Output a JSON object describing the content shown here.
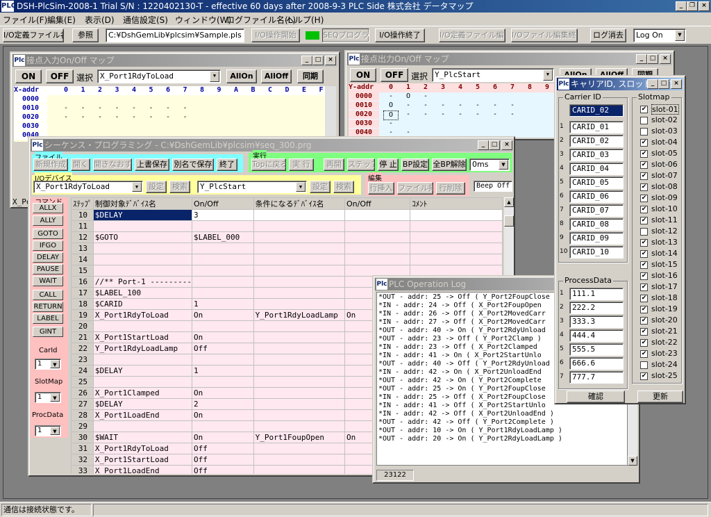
{
  "app": {
    "title": "DSH-PlcSim-2008-1 Trial S/N : 1220402130-T - effective 60 days after 2008-9-3     PLC Side  株式会社  データマップ",
    "logo": "PLC"
  },
  "menu": [
    "ファイル(F)",
    "編集(E)",
    "表示(D)",
    "通信設定(S)",
    "ウィンドウ(W)",
    "ログファイル名(L)",
    "ヘルプ(H)"
  ],
  "toolbar": {
    "io_def_label": "I/O定義ファイル名",
    "ref_btn": "参照",
    "file_path": "C:¥DshGemLib¥plcsim¥Sample.pls",
    "io_start": "I/O操作開始",
    "seq_prog": "SEQプログラム",
    "io_end": "I/O操作終了",
    "io_def_edit": "I/O定義ファイル編集",
    "io_file_edit_end": "I/Oファイル編集終了",
    "log_clear": "ログ消去",
    "log_on": "Log On"
  },
  "input_map": {
    "title": "接点入力On/Off マップ",
    "on": "ON",
    "off": "OFF",
    "select": "選択",
    "select_value": "X_Port1RdyToLoad",
    "allon": "AllOn",
    "alloff": "AllOff",
    "sync": "同期",
    "xaddr": "X-addr",
    "cols": [
      "0",
      "1",
      "2",
      "3",
      "4",
      "5",
      "6",
      "7",
      "8",
      "9",
      "A",
      "B",
      "C",
      "D",
      "E",
      "F"
    ],
    "rows": [
      "0000",
      "0010",
      "0020",
      "0030",
      "0040"
    ],
    "footer": "X_Po"
  },
  "output_map": {
    "title": "接点出力On/Off マップ",
    "on": "ON",
    "off": "OFF",
    "select": "選択",
    "select_value": "Y_PlcStart",
    "allon": "AllOn",
    "alloff": "AllOff",
    "sync": "同期",
    "yaddr": "Y-addr",
    "cols": [
      "0",
      "1",
      "2",
      "3",
      "4",
      "5",
      "6",
      "7",
      "8",
      "9"
    ],
    "rows": [
      "0000",
      "0010",
      "0020",
      "0030",
      "0040"
    ],
    "marks": {
      "r0": [
        "-",
        "O",
        "-"
      ],
      "r1": [
        "O",
        "-",
        "-",
        "-",
        "-",
        "-",
        "-",
        "-"
      ],
      "r2": [
        "O",
        "-",
        "-",
        "-",
        "-",
        "-",
        "-",
        "-"
      ],
      "r3": [
        "-"
      ],
      "r4": [
        "-",
        "-"
      ]
    }
  },
  "seq": {
    "title": "シーケンス・プログラミング - C:¥DshGemLib¥plcsim¥seq_300.prg",
    "file_label": "ファイル",
    "file_btns": [
      "新規作成",
      "開く",
      "開きなおす",
      "上書保存",
      "別名で保存",
      "終了"
    ],
    "exec_label": "実行",
    "exec_btns": [
      "Topに戻る",
      "実 行",
      "再開",
      "ステップ",
      "停 止",
      "BP設定",
      "全BP解除"
    ],
    "ms_value": "0ms",
    "io_label": "I/Oデバイス",
    "io_in": "X_Port1RdyToLoad",
    "set1": "設定",
    "search1": "検索",
    "io_out": "Y_PlcStart",
    "set2": "設定",
    "search2": "検索",
    "edit_label": "編集",
    "edit_btns": [
      "行挿入",
      "ファイル挿入",
      "行削除"
    ],
    "beep": "Beep Off",
    "cmd_label": "コマンド",
    "cmds": [
      "ALLX",
      "ALLY",
      "GOTO",
      "IFGO",
      "DELAY",
      "PAUSE",
      "WAIT",
      "CALL",
      "RETURN",
      "LABEL",
      "GINT"
    ],
    "carid_label": "CarId",
    "slotmap_label": "SlotMap",
    "procdata_label": "ProcData",
    "spin_value": "1",
    "headers": [
      "ｽﾃｯﾌﾟ",
      "制御対象ﾃﾞﾊﾞｲｽ名",
      "On/Off",
      "条件になるﾃﾞﾊﾞｲｽ名",
      "On/Off",
      "ｺﾒﾝﾄ"
    ],
    "rows": [
      [
        "10",
        "$DELAY",
        "3",
        "",
        "",
        ""
      ],
      [
        "11",
        "",
        "",
        "",
        "",
        ""
      ],
      [
        "12",
        "$GOTO",
        "$LABEL_000",
        "",
        "",
        ""
      ],
      [
        "13",
        "",
        "",
        "",
        "",
        ""
      ],
      [
        "14",
        "",
        "",
        "",
        "",
        ""
      ],
      [
        "15",
        "",
        "",
        "",
        "",
        ""
      ],
      [
        "16",
        "//** Port-1 ---------",
        "",
        "",
        "",
        ""
      ],
      [
        "17",
        "$LABEL_100",
        "",
        "",
        "",
        ""
      ],
      [
        "18",
        "$CARID",
        "1",
        "",
        "",
        ""
      ],
      [
        "19",
        "X_Port1RdyToLoad",
        "On",
        "Y_Port1RdyLoadLamp",
        "On",
        ""
      ],
      [
        "20",
        "",
        "",
        "",
        "",
        ""
      ],
      [
        "21",
        "X_Port1StartLoad",
        "On",
        "",
        "",
        ""
      ],
      [
        "22",
        "Y_Port1RdyLoadLamp",
        "Off",
        "",
        "",
        ""
      ],
      [
        "23",
        "",
        "",
        "",
        "",
        ""
      ],
      [
        "24",
        "$DELAY",
        "1",
        "",
        "",
        ""
      ],
      [
        "25",
        "",
        "",
        "",
        "",
        ""
      ],
      [
        "26",
        "X_Port1Clamped",
        "On",
        "",
        "",
        ""
      ],
      [
        "27",
        "$DELAY",
        "2",
        "",
        "",
        ""
      ],
      [
        "28",
        "X_Port1LoadEnd",
        "On",
        "",
        "",
        ""
      ],
      [
        "29",
        "",
        "",
        "",
        "",
        ""
      ],
      [
        "30",
        "$WAIT",
        "On",
        "Y_Port1FoupOpen",
        "On",
        ""
      ],
      [
        "31",
        "X_Port1RdyToLoad",
        "Off",
        "",
        "",
        ""
      ],
      [
        "32",
        "X_Port1StartLoad",
        "Off",
        "",
        "",
        ""
      ],
      [
        "33",
        "X_Port1LoadEnd",
        "Off",
        "",
        "",
        ""
      ]
    ]
  },
  "log": {
    "title": "PLC Operation Log",
    "lines": [
      "*OUT - addr:   25 -> Off ( Y_Port2FoupClose",
      "*IN  - addr:   24 -> Off ( X_Port2FoupOpen",
      "*IN  - addr:   26 -> Off ( X_Port2MovedCarr",
      "*IN  - addr:   27 -> Off ( X_Port2MovedCarr",
      "*OUT - addr:   40 -> On  ( Y_Port2RdyUnload",
      "*OUT - addr:   23 -> Off ( Y_Port2Clamp )",
      "*IN  - addr:   23 -> Off ( X_Port2Clamped",
      "*IN  - addr:   41 -> On  ( X_Port2StartUnlo",
      "*OUT - addr:   40 -> Off ( Y_Port2RdyUnload",
      "*IN  - addr:   42 -> On  ( X_Port2UnloadEnd",
      "*OUT - addr:   42 -> On  ( Y_Port2Complete",
      "*OUT - addr:   25 -> On  ( Y_Port2FoupClose",
      "*IN  - addr:   25 -> Off ( X_Port2FoupClose",
      "*IN  - addr:   41 -> Off ( X_Port2StartUnlo",
      "*IN  - addr:   42 -> Off ( X_Port2UnloadEnd )",
      "*OUT - addr:   42 -> Off ( Y_Port2Complete )",
      "*OUT - addr:   10 -> On  ( Y_Port1RdyLoadLamp )",
      "*OUT - addr:   20 -> On  ( Y_Port2RdyLoadLamp )"
    ],
    "count": "23122"
  },
  "carrier": {
    "title": "キャリアID, スロットマップ, ...",
    "carrier_label": "Carrier ID",
    "selected": "CARID_02",
    "ids": [
      "CARID_01",
      "CARID_02",
      "CARID_03",
      "CARID_04",
      "CARID_05",
      "CARID_06",
      "CARID_07",
      "CARID_08",
      "CARID_09",
      "CARID_10"
    ],
    "nums": [
      "1",
      "2",
      "3",
      "4",
      "5",
      "6",
      "7",
      "8",
      "9",
      "10"
    ],
    "slot_label": "Slotmap",
    "slots": [
      {
        "n": "slot-01",
        "c": true
      },
      {
        "n": "slot-02",
        "c": false
      },
      {
        "n": "slot-03",
        "c": false
      },
      {
        "n": "slot-04",
        "c": true
      },
      {
        "n": "slot-05",
        "c": true
      },
      {
        "n": "slot-06",
        "c": true
      },
      {
        "n": "slot-07",
        "c": true
      },
      {
        "n": "slot-08",
        "c": true
      },
      {
        "n": "slot-09",
        "c": true
      },
      {
        "n": "slot-10",
        "c": true
      },
      {
        "n": "slot-11",
        "c": true
      },
      {
        "n": "slot-12",
        "c": false
      },
      {
        "n": "slot-13",
        "c": true
      },
      {
        "n": "slot-14",
        "c": true
      },
      {
        "n": "slot-15",
        "c": true
      },
      {
        "n": "slot-16",
        "c": true
      },
      {
        "n": "slot-17",
        "c": true
      },
      {
        "n": "slot-18",
        "c": true
      },
      {
        "n": "slot-19",
        "c": true
      },
      {
        "n": "slot-20",
        "c": true
      },
      {
        "n": "slot-21",
        "c": true
      },
      {
        "n": "slot-22",
        "c": true
      },
      {
        "n": "slot-23",
        "c": true
      },
      {
        "n": "slot-24",
        "c": false
      },
      {
        "n": "slot-25",
        "c": true
      }
    ],
    "proc_label": "ProcessData",
    "proc": [
      "111.1",
      "222.2",
      "333.3",
      "444.4",
      "555.5",
      "666.6",
      "777.7"
    ],
    "proc_nums": [
      "1",
      "2",
      "3",
      "4",
      "5",
      "6",
      "7"
    ],
    "ok": "確認",
    "update": "更新"
  },
  "status": {
    "text": "通信は接続状態です。"
  }
}
